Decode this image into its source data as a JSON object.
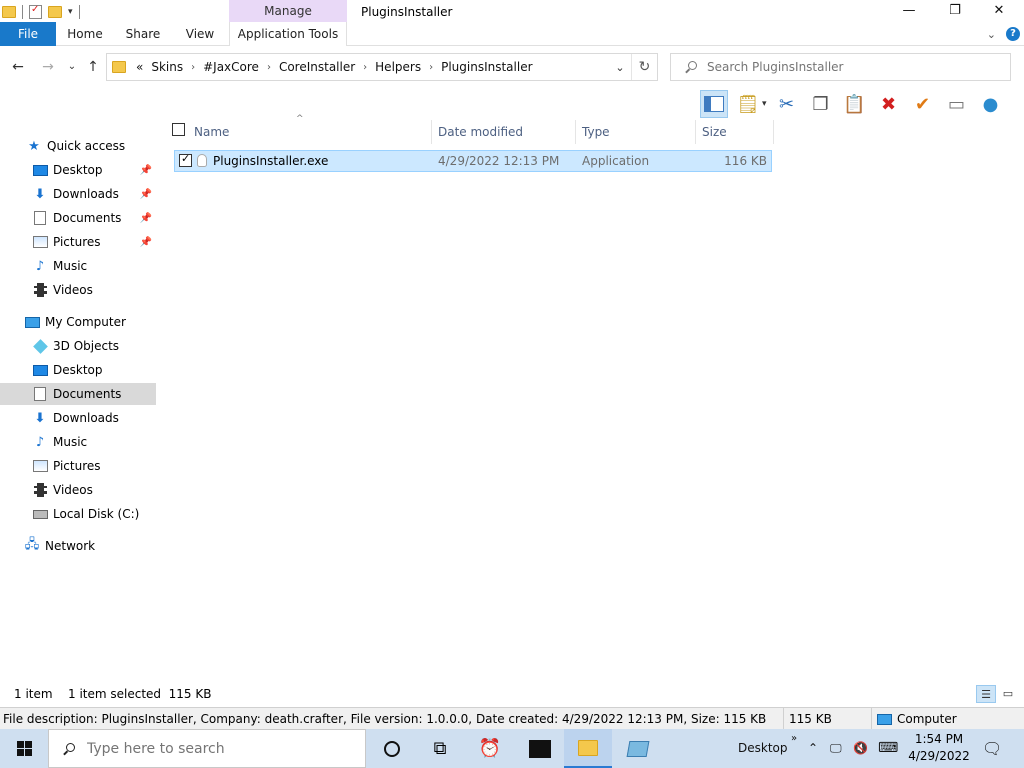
{
  "window": {
    "title": "PluginsInstaller",
    "manage_label": "Manage"
  },
  "ribbon": {
    "tabs": [
      {
        "label": "File"
      },
      {
        "label": "Home"
      },
      {
        "label": "Share"
      },
      {
        "label": "View"
      },
      {
        "label": "Application Tools"
      }
    ]
  },
  "address": {
    "overflow": "«",
    "crumbs": [
      "Skins",
      "#JaxCore",
      "CoreInstaller",
      "Helpers",
      "PluginsInstaller"
    ]
  },
  "search": {
    "placeholder": "Search PluginsInstaller"
  },
  "nav": {
    "quick_access": "Quick access",
    "quick_items": [
      "Desktop",
      "Downloads",
      "Documents",
      "Pictures",
      "Music",
      "Videos"
    ],
    "computer": "My Computer",
    "computer_items": [
      "3D Objects",
      "Desktop",
      "Documents",
      "Downloads",
      "Music",
      "Pictures",
      "Videos",
      "Local Disk (C:)"
    ],
    "network": "Network"
  },
  "columns": {
    "name": "Name",
    "date": "Date modified",
    "type": "Type",
    "size": "Size"
  },
  "files": [
    {
      "name": "PluginsInstaller.exe",
      "date": "4/29/2022 12:13 PM",
      "type": "Application",
      "size": "116 KB",
      "selected": true
    }
  ],
  "status": {
    "count": "1 item",
    "selected": "1 item selected  115 KB"
  },
  "description": {
    "text": "File description: PluginsInstaller, Company: death.crafter, File version: 1.0.0.0, Date created: 4/29/2022 12:13 PM, Size: 115 KB",
    "size": "115 KB",
    "location": "Computer"
  },
  "taskbar": {
    "search_placeholder": "Type here to search",
    "desktop_label": "Desktop",
    "overflow": "»",
    "time": "1:54 PM",
    "date": "4/29/2022"
  },
  "colors": {
    "accent": "#1979ca",
    "selection": "#cce8ff",
    "manage_tab": "#e9d9f7"
  }
}
